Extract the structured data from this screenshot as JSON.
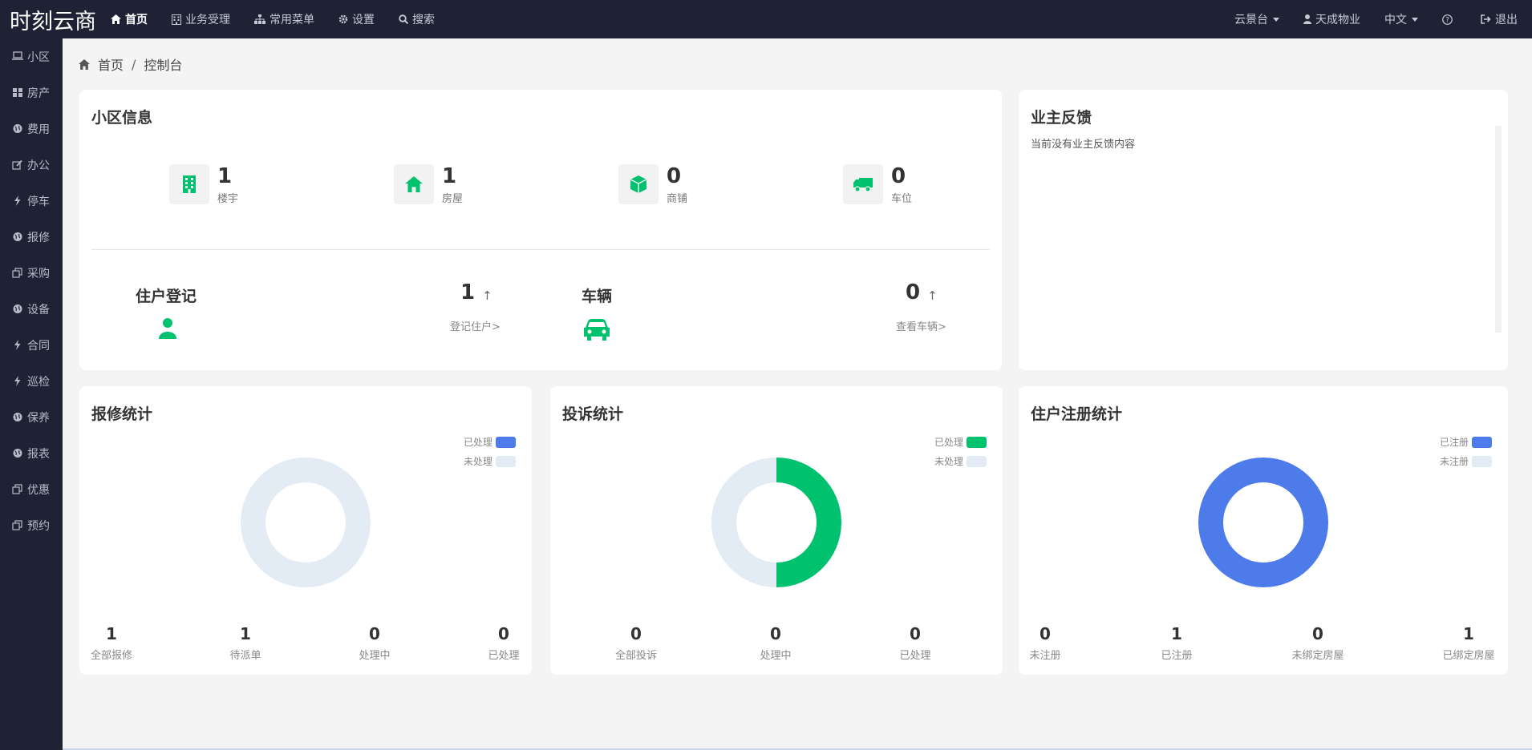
{
  "app": {
    "logo": "时刻云商"
  },
  "topnav": [
    {
      "label": "首页",
      "icon": "home-icon",
      "active": true
    },
    {
      "label": "业务受理",
      "icon": "building-icon"
    },
    {
      "label": "常用菜单",
      "icon": "sitemap-icon"
    },
    {
      "label": "设置",
      "icon": "gear-icon"
    },
    {
      "label": "搜索",
      "icon": "search-icon"
    }
  ],
  "topright": {
    "platform": "云景台",
    "user": "天成物业",
    "lang": "中文",
    "help": "?",
    "logout": "退出"
  },
  "sidebar": [
    {
      "label": "小区",
      "icon": "laptop-icon"
    },
    {
      "label": "房产",
      "icon": "grid-icon"
    },
    {
      "label": "费用",
      "icon": "globe-icon"
    },
    {
      "label": "办公",
      "icon": "edit-icon"
    },
    {
      "label": "停车",
      "icon": "bolt-icon"
    },
    {
      "label": "报修",
      "icon": "globe-icon"
    },
    {
      "label": "采购",
      "icon": "copy-icon"
    },
    {
      "label": "设备",
      "icon": "globe-icon"
    },
    {
      "label": "合同",
      "icon": "bolt-icon"
    },
    {
      "label": "巡检",
      "icon": "bolt-icon"
    },
    {
      "label": "保养",
      "icon": "globe-icon"
    },
    {
      "label": "报表",
      "icon": "globe-icon"
    },
    {
      "label": "优惠",
      "icon": "copy-icon"
    },
    {
      "label": "预约",
      "icon": "copy-icon"
    }
  ],
  "breadcrumb": {
    "home": "首页",
    "sep": "/",
    "current": "控制台"
  },
  "community": {
    "title": "小区信息",
    "stats": [
      {
        "value": "1",
        "label": "楼宇",
        "icon": "building-icon"
      },
      {
        "value": "1",
        "label": "房屋",
        "icon": "home-icon"
      },
      {
        "value": "0",
        "label": "商铺",
        "icon": "cube-icon"
      },
      {
        "value": "0",
        "label": "车位",
        "icon": "truck-icon"
      }
    ],
    "resident": {
      "title": "住户登记",
      "value": "1",
      "arrow": "↑",
      "link": "登记住户>"
    },
    "vehicle": {
      "title": "车辆",
      "value": "0",
      "arrow": "↑",
      "link": "查看车辆>"
    }
  },
  "feedback": {
    "title": "业主反馈",
    "empty": "当前没有业主反馈内容"
  },
  "repair": {
    "title": "报修统计",
    "legend": [
      {
        "label": "已处理",
        "color": "#4e7bea"
      },
      {
        "label": "未处理",
        "color": "#e3ebf4"
      }
    ],
    "footer": [
      {
        "value": "1",
        "label": "全部报修"
      },
      {
        "value": "1",
        "label": "待派单"
      },
      {
        "value": "0",
        "label": "处理中"
      },
      {
        "value": "0",
        "label": "已处理"
      }
    ]
  },
  "complaint": {
    "title": "投诉统计",
    "legend": [
      {
        "label": "已处理",
        "color": "#00c26e"
      },
      {
        "label": "未处理",
        "color": "#e3ebf4"
      }
    ],
    "footer": [
      {
        "value": "0",
        "label": "全部投诉"
      },
      {
        "value": "0",
        "label": "处理中"
      },
      {
        "value": "0",
        "label": "已处理"
      }
    ]
  },
  "register": {
    "title": "住户注册统计",
    "legend": [
      {
        "label": "已注册",
        "color": "#4e7bea"
      },
      {
        "label": "未注册",
        "color": "#e3ebf4"
      }
    ],
    "footer": [
      {
        "value": "0",
        "label": "未注册"
      },
      {
        "value": "1",
        "label": "已注册"
      },
      {
        "value": "0",
        "label": "未绑定房屋"
      },
      {
        "value": "1",
        "label": "已绑定房屋"
      }
    ]
  },
  "chart_data": [
    {
      "type": "pie",
      "categories": [
        "已处理",
        "未处理"
      ],
      "values": [
        0,
        1
      ],
      "colors": [
        "#4e7bea",
        "#e3ebf4"
      ]
    },
    {
      "type": "pie",
      "categories": [
        "已处理",
        "未处理"
      ],
      "values": [
        1,
        1
      ],
      "colors": [
        "#00c26e",
        "#e3ebf4"
      ]
    },
    {
      "type": "pie",
      "categories": [
        "已注册",
        "未注册"
      ],
      "values": [
        1,
        0
      ],
      "colors": [
        "#4e7bea",
        "#e3ebf4"
      ]
    }
  ]
}
